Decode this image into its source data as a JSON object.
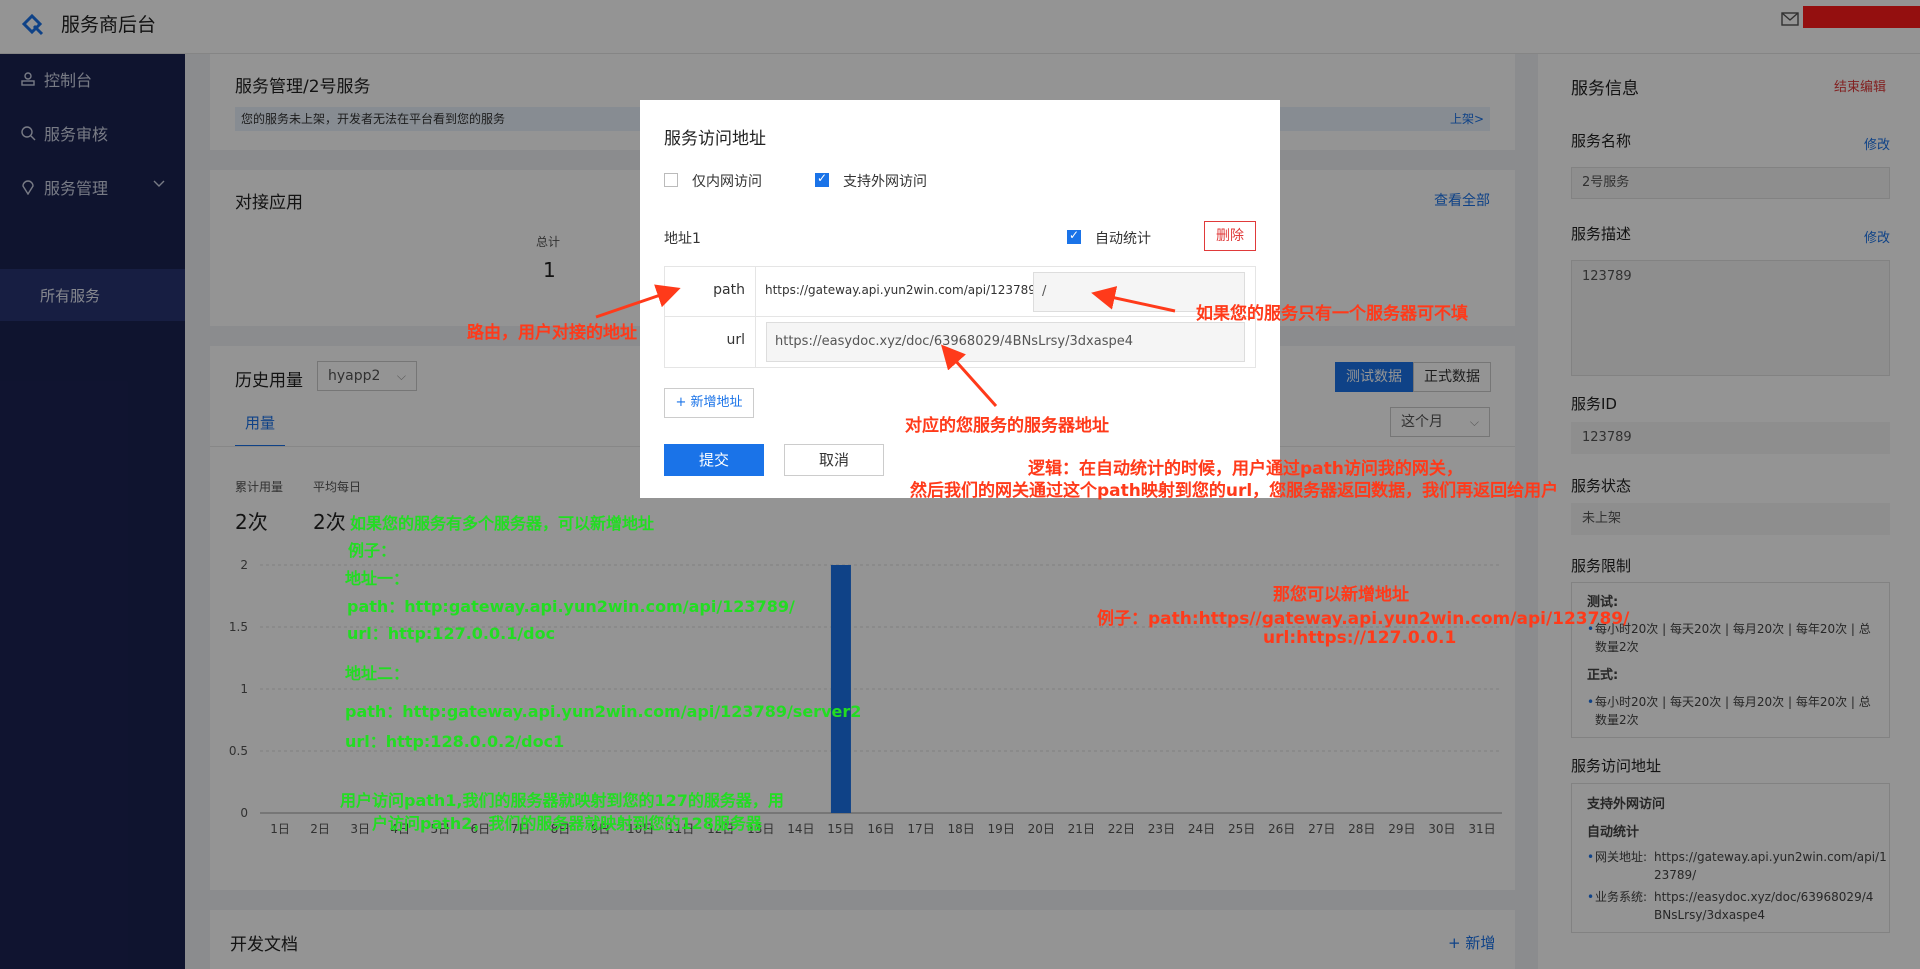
{
  "header": {
    "brand": "服务商后台"
  },
  "sidebar": {
    "items": [
      {
        "label": "控制台"
      },
      {
        "label": "服务审核"
      },
      {
        "label": "服务管理"
      }
    ],
    "sub_item": "所有服务"
  },
  "main": {
    "breadcrumb": "服务管理/2号服务",
    "notice": "您的服务未上架，开发者无法在平台看到您的服务",
    "notice_link": "上架>",
    "apps_title": "对接应用",
    "apps_view_all": "查看全部",
    "total_label": "总计",
    "total_value": "1",
    "history_title": "历史用量",
    "app_select": "hyapp2",
    "usage_tab": "用量",
    "test_data": "测试数据",
    "prod_data": "正式数据",
    "period_select": "这个月",
    "cumulative_label": "累计用量",
    "daily_label": "平均每日",
    "cumulative_value": "2次",
    "daily_value": "2次",
    "docs_title": "开发文档",
    "docs_add": "+ 新增"
  },
  "chart_data": {
    "type": "bar",
    "categories": [
      "1日",
      "2日",
      "3日",
      "4日",
      "5日",
      "6日",
      "7日",
      "8日",
      "9日",
      "10日",
      "11日",
      "12日",
      "13日",
      "14日",
      "15日",
      "16日",
      "17日",
      "18日",
      "19日",
      "20日",
      "21日",
      "22日",
      "23日",
      "24日",
      "25日",
      "26日",
      "27日",
      "28日",
      "29日",
      "30日",
      "31日"
    ],
    "values": [
      0,
      0,
      0,
      0,
      0,
      0,
      0,
      0,
      0,
      0,
      0,
      0,
      0,
      0,
      2,
      0,
      0,
      0,
      0,
      0,
      0,
      0,
      0,
      0,
      0,
      0,
      0,
      0,
      0,
      0,
      0
    ],
    "yticks": [
      "0",
      "0.5",
      "1",
      "1.5",
      "2"
    ],
    "ylim": [
      0,
      2
    ],
    "grid": true,
    "color": "#1a73e8"
  },
  "right_panel": {
    "title": "服务信息",
    "end_edit": "结束编辑",
    "name_label": "服务名称",
    "name_edit": "修改",
    "name_value": "2号服务",
    "desc_label": "服务描述",
    "desc_edit": "修改",
    "desc_value": "123789",
    "id_label": "服务ID",
    "id_value": "123789",
    "status_label": "服务状态",
    "status_value": "未上架",
    "limit_label": "服务限制",
    "limit_test_title": "测试:",
    "limit_test_text1": "每小时20次 | 每天20次 | 每月20次 | 每年20次 | 总",
    "limit_test_text2": "数量2次",
    "limit_prod_title": "正式:",
    "limit_prod_text1": "每小时20次 | 每天20次 | 每月20次 | 每年20次 | 总",
    "limit_prod_text2": "数量2次",
    "addr_label": "服务访问地址",
    "addr_mode": "支持外网访问",
    "addr_auto": "自动统计",
    "gw_label": "网关地址:",
    "gw_value1": "https://gateway.api.yun2win.com/api/1",
    "gw_value2": "23789/",
    "biz_label": "业务系统:",
    "biz_value1": "https://easydoc.xyz/doc/63968029/4",
    "biz_value2": "BNsLrsy/3dxaspe4"
  },
  "modal": {
    "title": "服务访问地址",
    "intranet_label": "仅内网访问",
    "extranet_label": "支持外网访问",
    "address_label": "地址1",
    "auto_stat_label": "自动统计",
    "delete_label": "删除",
    "path_label": "path",
    "path_prefix": "https://gateway.api.yun2win.com/api/123789",
    "path_value": "/",
    "url_label": "url",
    "url_value": "https://easydoc.xyz/doc/63968029/4BNsLrsy/3dxaspe4",
    "add_address": "+ 新增地址",
    "submit": "提交",
    "cancel": "取消"
  },
  "annotations": {
    "route": "路由，用户对接的地址",
    "single_server": "如果您的服务只有一个服务器可不填",
    "server_addr": "对应的您服务的服务器地址",
    "logic1": "逻辑：在自动统计的时候，用户通过path访问我的网关，",
    "logic2": "然后我们的网关通过这个path映射到您的url，您服务器返回数据，我们再返回给用户",
    "multi1": "如果您的服务有多个服务器，可以新增地址",
    "multi2": "例子：",
    "multi3": "地址一：",
    "multi4": "path：http:gateway.api.yun2win.com/api/123789/",
    "multi5": " url：http:127.0.0.1/doc",
    "multi6": "地址二：",
    "multi7": "path：http:gateway.api.yun2win.com/api/123789/server2",
    "multi8": "url：http:128.0.0.2/doc1",
    "multi9": "用户访问path1,我们的服务器就映射到您的127的服务器，用",
    "multi10": "户访问path2，我们的服务器就映射到您的128服务器",
    "new1": "那您可以新增地址",
    "new2": "例子：path:https//gateway.api.yun2win.com/api/123789/",
    "new3": "url:https://127.0.0.1"
  }
}
